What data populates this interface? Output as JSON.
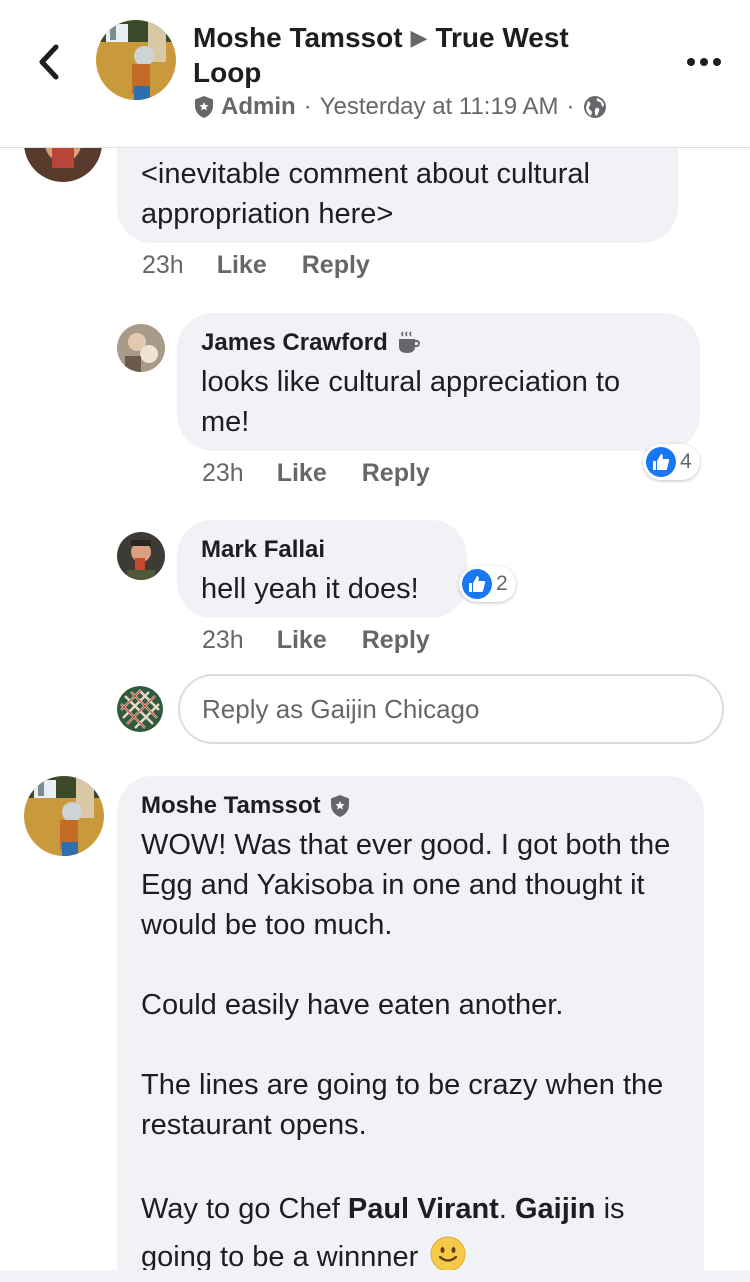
{
  "header": {
    "author": "Moshe Tamssot",
    "group": "True West Loop",
    "role": "Admin",
    "time": "Yesterday at 11:19 AM",
    "meta_sep": "·"
  },
  "comments": [
    {
      "text": "<inevitable comment about cultural appropriation here>",
      "time": "23h",
      "like_label": "Like",
      "reply_label": "Reply"
    },
    {
      "author": "James Crawford",
      "text": "looks like cultural appreciation to me!",
      "time": "23h",
      "like_label": "Like",
      "reply_label": "Reply",
      "reactions": "4"
    },
    {
      "author": "Mark Fallai",
      "text": "hell yeah it does!",
      "time": "23h",
      "like_label": "Like",
      "reply_label": "Reply",
      "reactions": "2"
    }
  ],
  "reply_input": {
    "placeholder": "Reply as Gaijin Chicago"
  },
  "main_comment": {
    "author": "Moshe Tamssot",
    "paragraphs": [
      "WOW! Was that ever good. I got both the Egg and Yakisoba in one and thought it would be too much.",
      "Could easily have eaten another.",
      "The lines are going to be crazy when the restaurant opens."
    ],
    "last": {
      "p1": "Way to go Chef ",
      "b1": "Paul Virant",
      "p2": ". ",
      "b2": "Gaijin",
      "p3": " is going to be a winnner"
    }
  },
  "icons": {
    "back": "chevron-left-icon",
    "more": "more-dots-icon",
    "admin": "shield-icon",
    "audience": "globe-icon",
    "coffee": "coffee-cup-icon",
    "like": "thumbs-up-icon",
    "emoji": "smiley-emoji-icon"
  },
  "colors": {
    "accent": "#1877f2",
    "bubble": "#f0f2f5",
    "secondary_text": "#65676b"
  }
}
